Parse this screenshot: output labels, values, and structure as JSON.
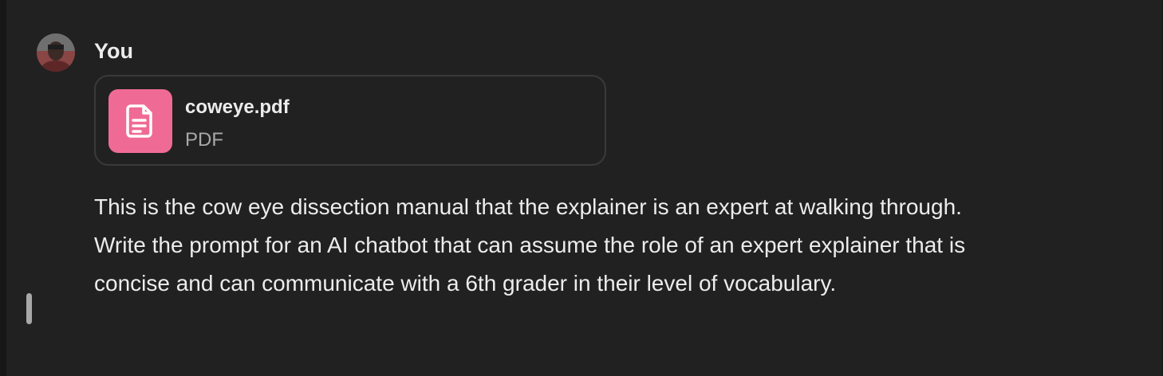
{
  "message": {
    "author": "You",
    "attachment": {
      "file_name": "coweye.pdf",
      "file_type": "PDF",
      "icon": "document-icon"
    },
    "text": "This is the cow eye dissection manual that the explainer is an expert at walking through. Write the prompt for an AI chatbot that can assume the role of an expert explainer that is concise and can communicate with a 6th grader in their level of vocabulary."
  },
  "colors": {
    "background": "#212121",
    "text": "#ececec",
    "muted_text": "#a9a9a9",
    "file_icon_bg": "#ef6b95",
    "card_border": "#3a3a3a"
  }
}
